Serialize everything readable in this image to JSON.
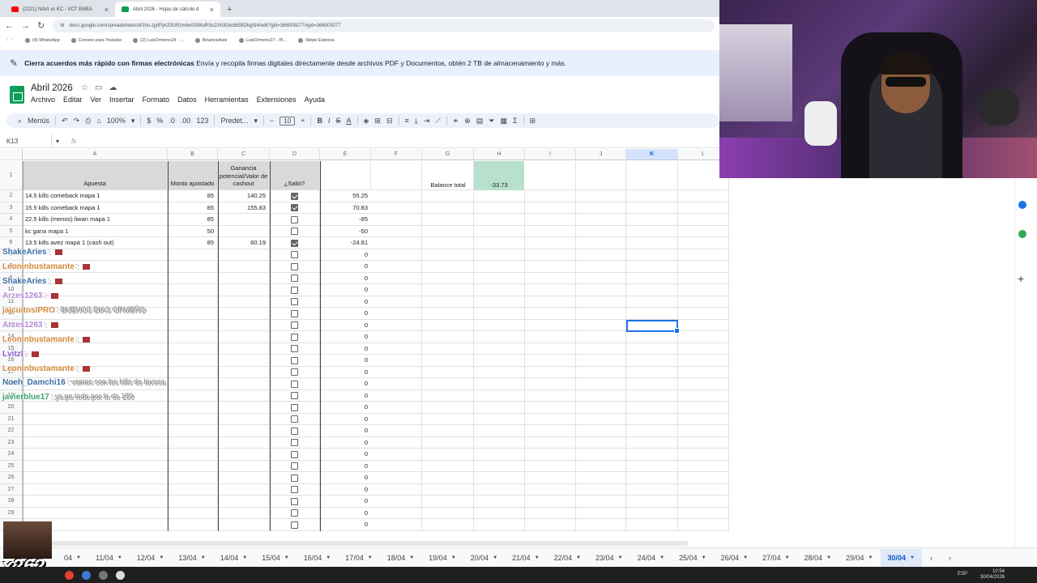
{
  "browser": {
    "tabs": [
      {
        "label": "(2221) NAVI vs KC - VCT EMEA",
        "color": "#ff0000"
      },
      {
        "label": "Abril 2026 - Hojas de cálculo d",
        "color": "#0f9d58"
      }
    ],
    "url": "docs.google.com/spreadsheets/d/1hs-zjyIPyk23URzmlwASlMuRSo2Xh3Gedb5BDkgSi4/edit?gid=366009277#gid=366009277",
    "bookmarks": [
      "(4) WhatsApp",
      "Correos para Youtube",
      "(2) LuisOrmeno24 - ...",
      "BinanceAxie",
      "LuisOrmeno27 - Pl...",
      "Stripe Express"
    ]
  },
  "banner": {
    "bold": "Cierra acuerdos más rápido con firmas electrónicas",
    "text": "Envía y recopila firmas digitales directamente desde archivos PDF y Documentos, obtén 2 TB de almacenamiento y más."
  },
  "doc": {
    "title": "Abril 2026",
    "menu": [
      "Archivo",
      "Editar",
      "Ver",
      "Insertar",
      "Formato",
      "Datos",
      "Herramientas",
      "Extensiones",
      "Ayuda"
    ]
  },
  "toolbar": {
    "menus_label": "Menús",
    "zoom": "100%",
    "currency": "$",
    "percent": "%",
    "dec_less": ".0",
    "dec_more": ".00",
    "numfmt": "123",
    "font": "Predet...",
    "font_size": "10",
    "bold": "B",
    "italic": "I",
    "strike": "S",
    "textcolor": "A"
  },
  "formula": {
    "namebox": "K13",
    "fx": "fx"
  },
  "columns": [
    "A",
    "B",
    "C",
    "D",
    "E",
    "F",
    "G",
    "H",
    "I",
    "J",
    "K",
    "L"
  ],
  "headers": {
    "apuesta": "Apuesta",
    "monto": "Monto apostado",
    "ganancia": "Ganancia potencial/Valor de cashout",
    "salio": "¿Salió?",
    "balance_label": "Balance total",
    "balance_value": "-33.73"
  },
  "rows": [
    {
      "num": "2",
      "apuesta": "14.5 kills comeback mapa 1",
      "monto": "85",
      "ganancia": "140.25",
      "salio": true,
      "resultado": "55.25"
    },
    {
      "num": "3",
      "apuesta": "15.5 kills comeback mapa 1",
      "monto": "85",
      "ganancia": "155.83",
      "salio": true,
      "resultado": "70.83"
    },
    {
      "num": "4",
      "apuesta": "22.5 kills (menos) liwan mapa 1",
      "monto": "85",
      "ganancia": "",
      "salio": false,
      "resultado": "-85"
    },
    {
      "num": "5",
      "apuesta": "kc gana mapa 1",
      "monto": "50",
      "ganancia": "",
      "salio": false,
      "resultado": "-50"
    },
    {
      "num": "6",
      "apuesta": "13.5 kills avez mapa 1 (cash out)",
      "monto": "85",
      "ganancia": "60.19",
      "salio": true,
      "resultado": "-24.81"
    },
    {
      "num": "7",
      "apuesta": "",
      "monto": "",
      "ganancia": "",
      "salio": false,
      "resultado": "0"
    },
    {
      "num": "8",
      "apuesta": "",
      "monto": "",
      "ganancia": "",
      "salio": false,
      "resultado": "0"
    },
    {
      "num": "9",
      "apuesta": "",
      "monto": "",
      "ganancia": "",
      "salio": false,
      "resultado": "0"
    },
    {
      "num": "10",
      "apuesta": "",
      "monto": "",
      "ganancia": "",
      "salio": false,
      "resultado": "0"
    },
    {
      "num": "11",
      "apuesta": "",
      "monto": "",
      "ganancia": "",
      "salio": false,
      "resultado": "0"
    },
    {
      "num": "12",
      "apuesta": "",
      "monto": "",
      "ganancia": "",
      "salio": false,
      "resultado": "0"
    },
    {
      "num": "13",
      "apuesta": "",
      "monto": "",
      "ganancia": "",
      "salio": false,
      "resultado": "0"
    },
    {
      "num": "14",
      "apuesta": "",
      "monto": "",
      "ganancia": "",
      "salio": false,
      "resultado": "0"
    },
    {
      "num": "15",
      "apuesta": "",
      "monto": "",
      "ganancia": "",
      "salio": false,
      "resultado": "0"
    },
    {
      "num": "16",
      "apuesta": "",
      "monto": "",
      "ganancia": "",
      "salio": false,
      "resultado": "0"
    },
    {
      "num": "17",
      "apuesta": "",
      "monto": "",
      "ganancia": "",
      "salio": false,
      "resultado": "0"
    },
    {
      "num": "18",
      "apuesta": "",
      "monto": "",
      "ganancia": "",
      "salio": false,
      "resultado": "0"
    },
    {
      "num": "19",
      "apuesta": "",
      "monto": "",
      "ganancia": "",
      "salio": false,
      "resultado": "0"
    },
    {
      "num": "20",
      "apuesta": "",
      "monto": "",
      "ganancia": "",
      "salio": false,
      "resultado": "0"
    },
    {
      "num": "21",
      "apuesta": "",
      "monto": "",
      "ganancia": "",
      "salio": false,
      "resultado": "0"
    },
    {
      "num": "22",
      "apuesta": "",
      "monto": "",
      "ganancia": "",
      "salio": false,
      "resultado": "0"
    },
    {
      "num": "23",
      "apuesta": "",
      "monto": "",
      "ganancia": "",
      "salio": false,
      "resultado": "0"
    },
    {
      "num": "24",
      "apuesta": "",
      "monto": "",
      "ganancia": "",
      "salio": false,
      "resultado": "0"
    },
    {
      "num": "25",
      "apuesta": "",
      "monto": "",
      "ganancia": "",
      "salio": false,
      "resultado": "0"
    },
    {
      "num": "26",
      "apuesta": "",
      "monto": "",
      "ganancia": "",
      "salio": false,
      "resultado": "0"
    },
    {
      "num": "27",
      "apuesta": "",
      "monto": "",
      "ganancia": "",
      "salio": false,
      "resultado": "0"
    },
    {
      "num": "28",
      "apuesta": "",
      "monto": "",
      "ganancia": "",
      "salio": false,
      "resultado": "0"
    },
    {
      "num": "29",
      "apuesta": "",
      "monto": "",
      "ganancia": "",
      "salio": false,
      "resultado": "0"
    },
    {
      "num": "30",
      "apuesta": "",
      "monto": "",
      "ganancia": "",
      "salio": false,
      "resultado": "0"
    }
  ],
  "chat": [
    {
      "user": "ShakeAries",
      "msg": "",
      "color": "#3a6ea5"
    },
    {
      "user": "Leoninbustamante",
      "msg": "",
      "color": "#d4893a"
    },
    {
      "user": "ShakeAries",
      "msg": "",
      "color": "#3a6ea5"
    },
    {
      "user": "Arzes1263",
      "msg": "",
      "color": "#b58ad6"
    },
    {
      "user": "jajcuitosIPRO",
      "msg": "BUENOS DIAS ORMEÑO",
      "color": "#d4893a"
    },
    {
      "user": "Arzes1263",
      "msg": "",
      "color": "#b58ad6"
    },
    {
      "user": "Leoninbustamante",
      "msg": "",
      "color": "#d4893a"
    },
    {
      "user": "Lvitzl",
      "msg": "",
      "color": "#8a5ad6"
    },
    {
      "user": "Leoninbustamante",
      "msg": "",
      "color": "#d4893a"
    },
    {
      "user": "Noeh_Damchi16",
      "msg": "vamos con los kills de lavesa",
      "color": "#3a6ea5"
    },
    {
      "user": "javierblue17",
      "msg": "ya pe todo por la de 150",
      "color": "#3aa56e"
    }
  ],
  "sheet_tabs": [
    "04",
    "11/04",
    "12/04",
    "13/04",
    "14/04",
    "15/04",
    "16/04",
    "17/04",
    "18/04",
    "19/04",
    "20/04",
    "21/04",
    "22/04",
    "23/04",
    "24/04",
    "25/04",
    "26/04",
    "27/04",
    "28/04",
    "29/04",
    "30/04"
  ],
  "active_sheet": "30/04",
  "overlay": {
    "label": "x262"
  },
  "tray": {
    "lang": "ESP",
    "time": "10:54",
    "date": "30/04/2026"
  }
}
